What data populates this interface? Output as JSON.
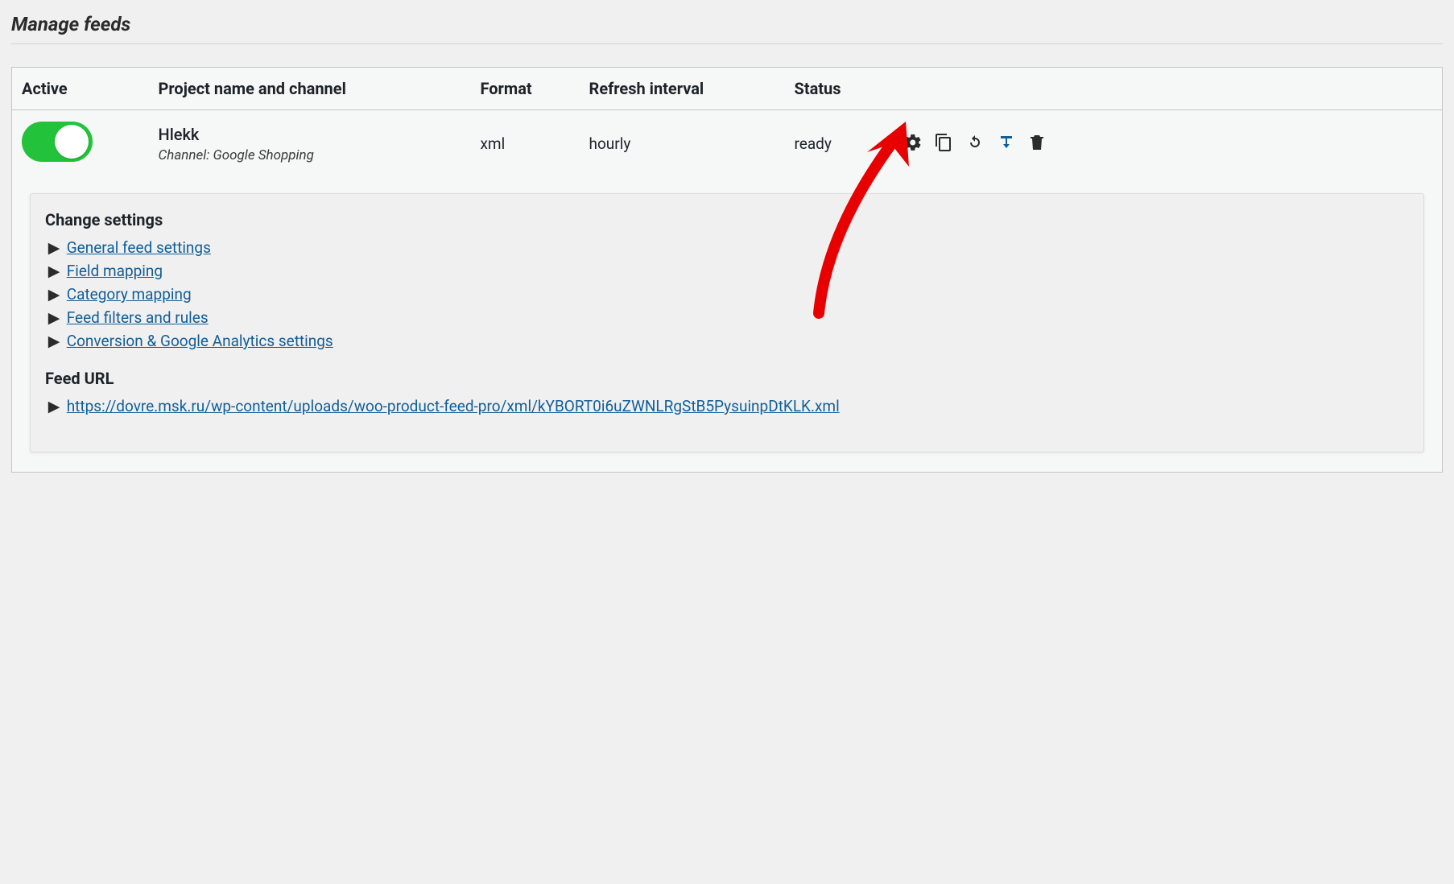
{
  "page_title": "Manage feeds",
  "headers": {
    "active": "Active",
    "project": "Project name and channel",
    "format": "Format",
    "refresh": "Refresh interval",
    "status": "Status"
  },
  "feed": {
    "name": "Hlekk",
    "channel_prefix": "Channel: ",
    "channel": "Google Shopping",
    "format": "xml",
    "refresh": "hourly",
    "status": "ready",
    "active": true
  },
  "settings": {
    "heading": "Change settings",
    "items": [
      "General feed settings",
      "Field mapping",
      "Category mapping",
      "Feed filters and rules",
      "Conversion & Google Analytics settings"
    ],
    "feed_url_heading": "Feed URL",
    "feed_url": "https://dovre.msk.ru/wp-content/uploads/woo-product-feed-pro/xml/kYBORT0i6uZWNLRgStB5PysuinpDtKLK.xml"
  }
}
